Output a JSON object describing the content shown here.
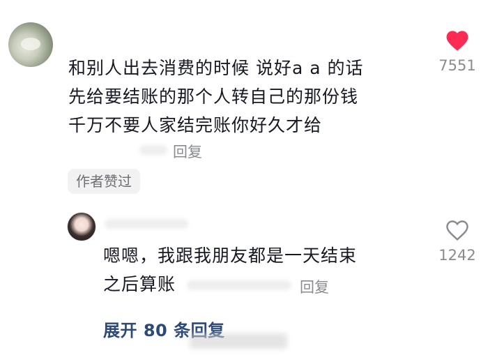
{
  "comment": {
    "lines": [
      "和别人出去消费的时候 说好a a 的话",
      "先给要结账的那个人转自己的那份钱",
      "千万不要人家结完账你好久才给"
    ],
    "reply_label": "回复",
    "author_liked_label": "作者赞过",
    "like_count": "7551",
    "liked": true,
    "like_color": "#fe2c55"
  },
  "reply": {
    "lines": [
      "嗯嗯，我跟我朋友都是一天结束",
      "之后算账"
    ],
    "reply_label": "回复",
    "like_count": "1242",
    "liked": false
  },
  "expand_label": "展开 80 条回复",
  "link_color": "#2b4a7a"
}
